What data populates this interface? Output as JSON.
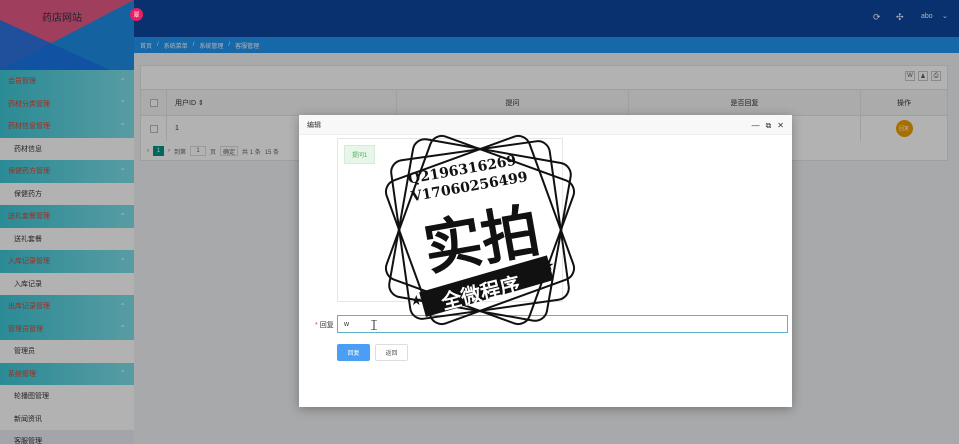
{
  "app": {
    "title": "药店网站",
    "badge": "翠"
  },
  "header": {
    "user": "abo",
    "icons": [
      "refresh-icon",
      "fullscreen-icon"
    ]
  },
  "breadcrumb": [
    "首页",
    "/",
    "系统菜单",
    "/",
    "系统管理",
    "/",
    "客服管理"
  ],
  "sidebar": [
    {
      "type": "group",
      "label": "会员管理"
    },
    {
      "type": "group",
      "label": "药材分类管理"
    },
    {
      "type": "group",
      "label": "药材信息管理"
    },
    {
      "type": "item",
      "label": "药材信息"
    },
    {
      "type": "group",
      "label": "保健药方管理"
    },
    {
      "type": "item",
      "label": "保健药方"
    },
    {
      "type": "group",
      "label": "送礼套餐管理"
    },
    {
      "type": "item",
      "label": "送礼套餐"
    },
    {
      "type": "group",
      "label": "入库记录管理"
    },
    {
      "type": "item",
      "label": "入库记录"
    },
    {
      "type": "group",
      "label": "出库记录管理"
    },
    {
      "type": "group",
      "label": "管理员管理"
    },
    {
      "type": "item",
      "label": "管理员"
    },
    {
      "type": "group",
      "label": "系统管理"
    },
    {
      "type": "item",
      "label": "轮播图管理"
    },
    {
      "type": "item",
      "label": "新闻资讯"
    },
    {
      "type": "item",
      "label": "客服管理",
      "active": true
    }
  ],
  "table": {
    "toolbar": [
      "W",
      "♟",
      "⎙"
    ],
    "headers": [
      "",
      "用户ID",
      "提问",
      "是否回复",
      "操作"
    ],
    "rows": [
      {
        "id": "1",
        "question": "",
        "replied": "",
        "action": "回复"
      }
    ],
    "pager": {
      "current": "1",
      "goto_label": "到第",
      "goto_value": "1",
      "page_unit": "页",
      "confirm": "确定",
      "total": "共 1 条",
      "page_size": "15 条"
    }
  },
  "modal": {
    "title": "编辑",
    "question_tag": "提问1",
    "reply_label": "回复",
    "reply_value": "w",
    "submit_label": "回复",
    "back_label": "返回"
  },
  "watermark": {
    "line1": "Q2196316269",
    "line2": "V17060256499",
    "big": "实拍",
    "ribbon": "全微程序"
  }
}
